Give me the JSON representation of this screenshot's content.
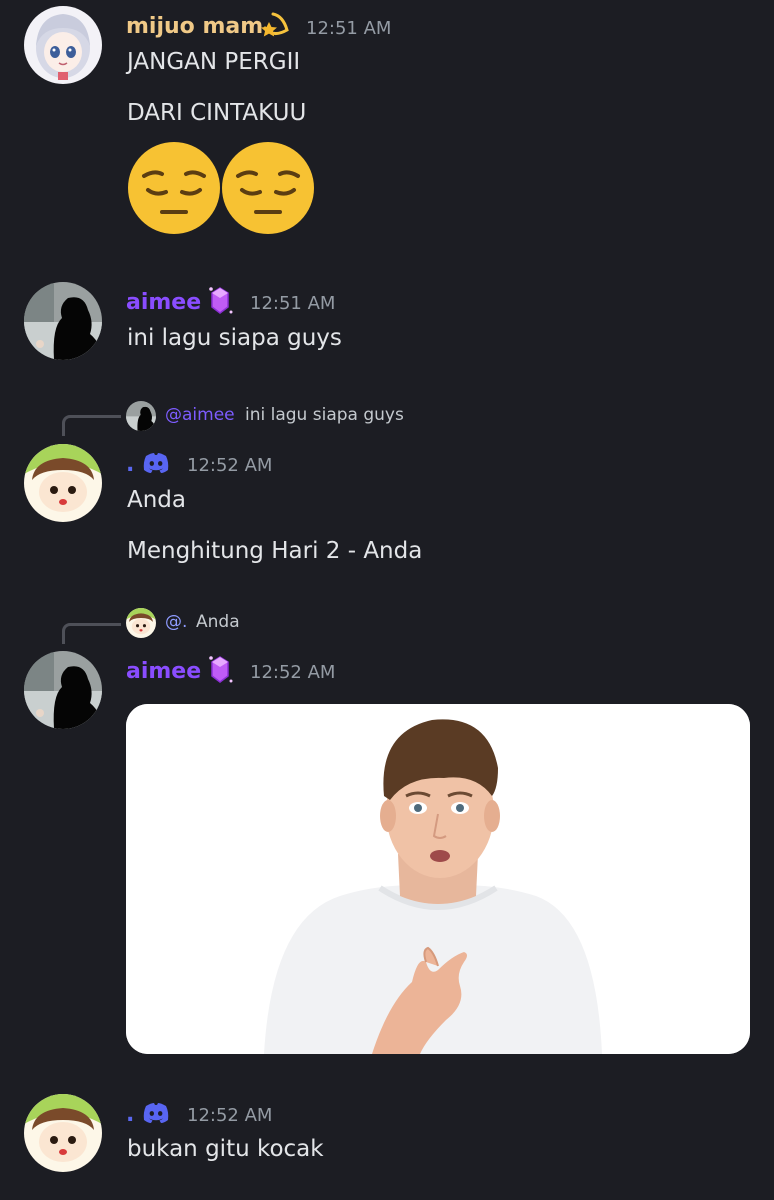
{
  "colors": {
    "background": "#1c1d23",
    "username_mijuo": "#f0c987",
    "username_aimee": "#8a4dff",
    "username_dot": "#5a67f0",
    "timestamp": "#949ba4",
    "message_text": "#e3e5e8",
    "mention": "#7d5cff"
  },
  "messages": [
    {
      "author": "mijuo mam",
      "author_badge_icon": "shooting-star-icon",
      "time": "12:51 AM",
      "lines": [
        "JANGAN PERGII",
        "DARI CINTAKUU"
      ],
      "emojis": [
        "pensive-face-emoji",
        "pensive-face-emoji"
      ]
    },
    {
      "author": "aimee",
      "author_badge_icon": "purple-gem-icon",
      "time": "12:51 AM",
      "lines": [
        "ini lagu siapa guys"
      ]
    },
    {
      "reply": {
        "mention": "@aimee",
        "text": "ini lagu siapa guys"
      },
      "author": ".",
      "author_badge_icon": "discord-icon",
      "time": "12:52 AM",
      "lines": [
        "Anda",
        "Menghitung Hari 2 - Anda"
      ]
    },
    {
      "reply": {
        "mention": "@.",
        "text": "Anda"
      },
      "author": "aimee",
      "author_badge_icon": "purple-gem-icon",
      "time": "12:52 AM",
      "attachment": "pointing-at-self-meme-image"
    },
    {
      "author": ".",
      "author_badge_icon": "discord-icon",
      "time": "12:52 AM",
      "lines": [
        "bukan gitu kocak"
      ]
    }
  ]
}
